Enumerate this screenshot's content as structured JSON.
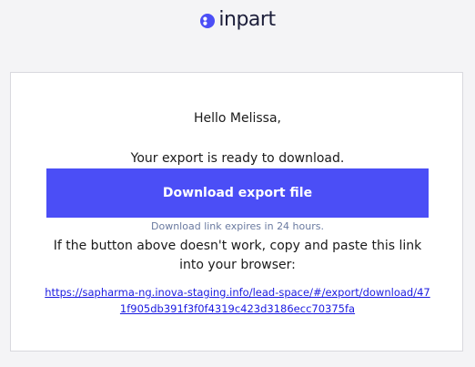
{
  "brand": {
    "name": "inpart",
    "logo_icon": "inpart-logo-icon",
    "mark_color": "#4b4ef6",
    "text_color": "#1c1e3a"
  },
  "email": {
    "greeting": "Hello Melissa,",
    "ready_text": "Your export is ready to download.",
    "button_label": "Download export file",
    "button_color": "#4b4ef6",
    "expires_text": "Download link expires in 24 hours.",
    "fallback_text": "If the button above doesn't work, copy and paste this link into your browser:",
    "link_url": "https://sapharma-ng.inova-staging.info/lead-space/#/export/download/471f905db391f3f0f4319c423d3186ecc70375fa"
  }
}
